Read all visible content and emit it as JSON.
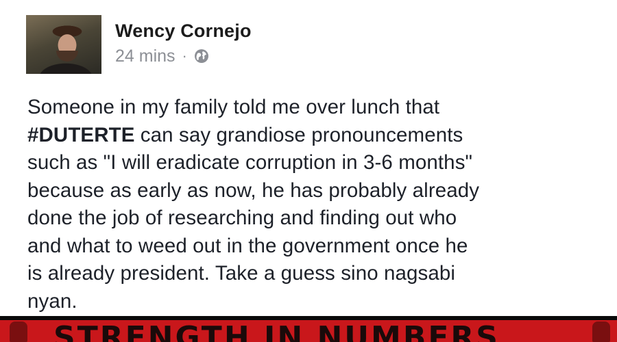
{
  "post": {
    "author": "Wency Cornejo",
    "timestamp": "24 mins",
    "separator": "·",
    "audience_icon": "globe-icon",
    "body_lines": [
      {
        "prefix": "",
        "hashtag": "",
        "text": "Someone in my family told me over lunch that"
      },
      {
        "prefix": "",
        "hashtag": "#DUTERTE",
        "text": " can say grandiose pronouncements"
      },
      {
        "prefix": "",
        "hashtag": "",
        "text": "such as \"I will eradicate corruption in 3-6 months\""
      },
      {
        "prefix": "",
        "hashtag": "",
        "text": "because as early as now, he has probably already"
      },
      {
        "prefix": "",
        "hashtag": "",
        "text": "done the job of researching and finding out who"
      },
      {
        "prefix": "",
        "hashtag": "",
        "text": "and what to weed out in the government once he"
      },
      {
        "prefix": "",
        "hashtag": "",
        "text": "is already president. Take a guess sino nagsabi"
      },
      {
        "prefix": "",
        "hashtag": "",
        "text": "nyan."
      }
    ]
  },
  "banner": {
    "text": "STRENGTH IN NUMBERS",
    "background_color": "#c9171b",
    "icon": "fist-icon"
  }
}
